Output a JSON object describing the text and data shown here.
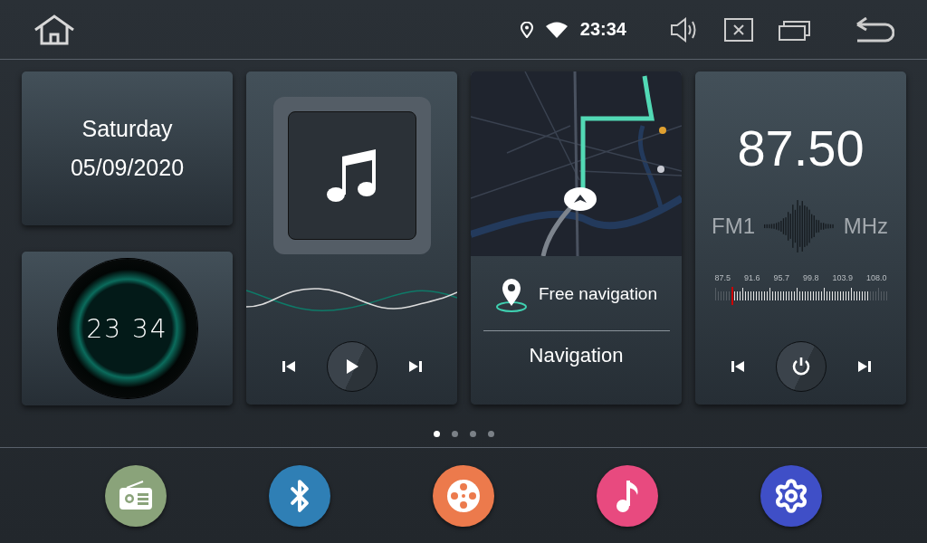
{
  "status_bar": {
    "time": "23:34"
  },
  "date_card": {
    "weekday": "Saturday",
    "date": "05/09/2020"
  },
  "clock_card": {
    "time": "23 34"
  },
  "music_card": {
    "playing": false
  },
  "navigation_card": {
    "action": "Free navigation",
    "title": "Navigation"
  },
  "radio_card": {
    "frequency": "87.50",
    "band": "FM1",
    "unit": "MHz",
    "dial": {
      "ticks": [
        "87.5",
        "91.6",
        "95.7",
        "99.8",
        "103.9",
        "108.0"
      ]
    }
  },
  "page_dots": [
    {
      "selected": true
    },
    {
      "selected": false
    },
    {
      "selected": false
    },
    {
      "selected": false
    }
  ],
  "dock": [
    {
      "kind": "radio",
      "color": "#8aa37a"
    },
    {
      "kind": "bluetooth",
      "color": "#2f7fb5"
    },
    {
      "kind": "video",
      "color": "#ec7a4c"
    },
    {
      "kind": "music",
      "color": "#e84a7f"
    },
    {
      "kind": "settings",
      "color": "#3f4fc7"
    }
  ]
}
